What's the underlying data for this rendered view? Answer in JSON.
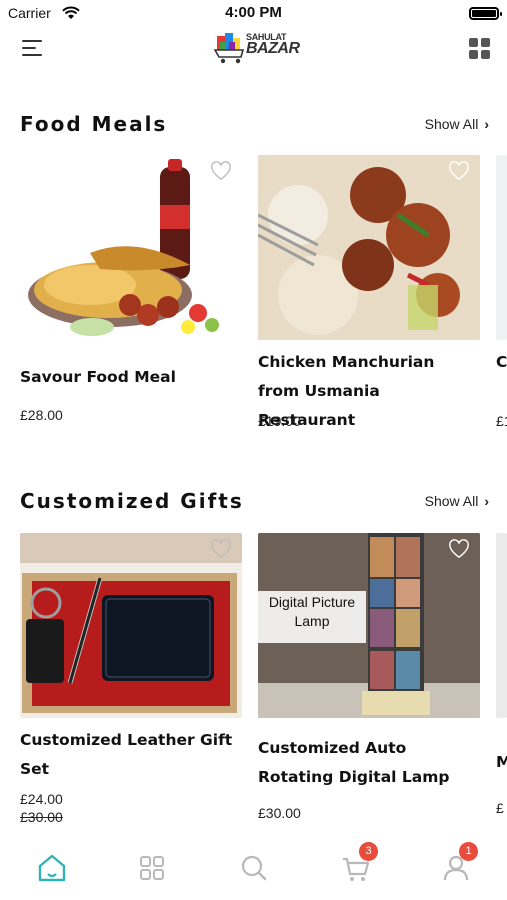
{
  "status_bar": {
    "carrier": "Carrier",
    "time": "4:00 PM"
  },
  "header": {
    "logo_small": "SAHULAT",
    "logo_big": "BAZAR"
  },
  "sections": [
    {
      "title": "Food Meals",
      "show_all": "Show All",
      "items": [
        {
          "name": "Savour Food Meal",
          "price": "£28.00"
        },
        {
          "name": "Chicken Manchurian from Usmania Restaurant",
          "price": "£19.00"
        },
        {
          "name": "C U",
          "price": "£1"
        }
      ]
    },
    {
      "title": "Customized Gifts",
      "show_all": "Show All",
      "items": [
        {
          "name": "Customized Leather Gift Set",
          "price": "£24.00",
          "old_price": "£30.00"
        },
        {
          "name": "Customized Auto Rotating Digital Lamp",
          "price": "£30.00",
          "image_caption": "Digital Picture Lamp"
        },
        {
          "name": "M",
          "price": "£"
        }
      ]
    }
  ],
  "tabbar": {
    "items": [
      "home-icon",
      "categories-icon",
      "search-icon",
      "cart-icon",
      "profile-icon"
    ],
    "cart_badge": "3",
    "profile_badge": "1",
    "active_color": "#2fb3b3",
    "inactive_color": "#b8b8b8"
  }
}
